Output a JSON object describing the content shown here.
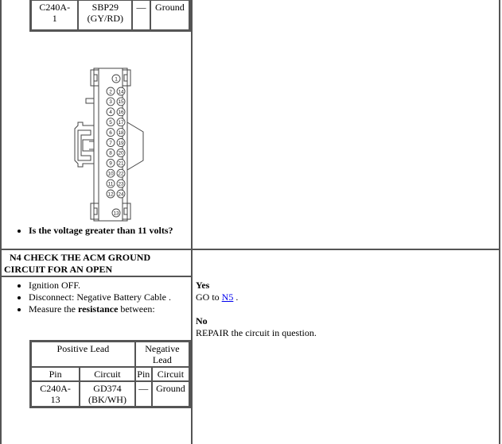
{
  "top_table": {
    "row": {
      "pin": "C240A-\n1",
      "pin_line1": "C240A-",
      "pin_line2": "1",
      "circuit_line1": "SBP29",
      "circuit_line2": "(GY/RD)",
      "neg_pin": "—",
      "neg_circuit": "Ground"
    }
  },
  "connector_diagram": {
    "pins_left": [
      "1",
      "2",
      "3",
      "4",
      "5",
      "6",
      "7",
      "8",
      "9",
      "10",
      "11",
      "12",
      "13"
    ],
    "pins_right": [
      "14",
      "15",
      "16",
      "17",
      "18",
      "19",
      "20",
      "21",
      "22",
      "23",
      "24"
    ]
  },
  "question": "Is the voltage greater than 11 volts?",
  "step_n4": {
    "title": "N4 CHECK THE ACM GROUND CIRCUIT FOR AN OPEN",
    "title_line1": "N4 CHECK THE ACM GROUND",
    "title_line2": "CIRCUIT FOR AN OPEN",
    "instructions": [
      {
        "text": "Ignition OFF."
      },
      {
        "text": "Disconnect: Negative Battery Cable ."
      },
      {
        "pre": "Measure the ",
        "bold": "resistance",
        "post": " between:"
      }
    ],
    "table": {
      "header_positive": "Positive Lead",
      "header_negative_line1": "Negative",
      "header_negative_line2": "Lead",
      "sub_pin": "Pin",
      "sub_circuit": "Circuit",
      "sub_pin2": "Pin",
      "sub_circuit2": "Circuit",
      "row": {
        "pin_line1": "C240A-",
        "pin_line2": "13",
        "circuit_line1": "GD374",
        "circuit_line2": "(BK/WH)",
        "neg_pin": "—",
        "neg_circuit": "Ground"
      }
    },
    "yes_label": "Yes",
    "yes_text_pre": "GO to ",
    "yes_link": "N5",
    "yes_text_post": " .",
    "no_label": "No",
    "no_text": "REPAIR the circuit in question."
  },
  "colors": {
    "border": "#555555",
    "link": "#0000ee"
  }
}
